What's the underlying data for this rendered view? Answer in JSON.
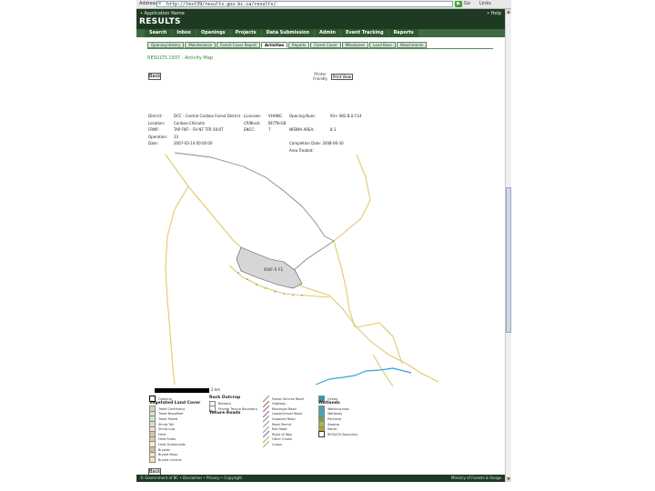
{
  "browser": {
    "address_label": "Address",
    "url": "http://test39/results.gov.bc.ca/results/",
    "go_label": "Go",
    "links_label": "Links"
  },
  "header": {
    "app_name": "• Application Name",
    "help_label": "• Help",
    "brand": "RESULTS"
  },
  "nav": {
    "items": [
      "Search",
      "Inbox",
      "Openings",
      "Projects",
      "Data Submission",
      "Admin",
      "Event Tracking",
      "Reports"
    ]
  },
  "subtabs": {
    "items": [
      "Opening History",
      "Maintenance",
      "Forest Cover Report",
      "Activities",
      "Reports",
      "Forest Cover",
      "Milestones",
      "Land Base",
      "Attachments"
    ],
    "active_index": 3
  },
  "page": {
    "title": "RESULTS 1937 - Activity Map",
    "back_label": "Back",
    "print_hint": "Printer Friendly",
    "print_label": "Print View"
  },
  "info": {
    "rows": [
      [
        "District:",
        "DCC - Central Cariboo Forest District",
        "Licensee:",
        "VHHNG",
        "Opening Num:",
        "93+ 082 B.0.F.14"
      ],
      [
        "Location:",
        "Cariboo-Chilcotin",
        "CP/Block:",
        "BF/TN-GB",
        "",
        ""
      ],
      [
        "FRMF:",
        "TAP FNT – FH NT TFR 58 BT",
        "ENCC:",
        "7",
        "NFBMA AREA:",
        "8.1"
      ],
      [
        "Operation:",
        "33",
        "",
        "",
        "",
        ""
      ],
      [
        "Date:",
        "2007-03-14 00:00:00",
        "",
        "",
        "Completion Date: 2008-06-30",
        ""
      ],
      [
        "",
        "",
        "",
        "",
        "Area Treated:",
        ""
      ]
    ]
  },
  "map": {
    "opening_label": "93/F-5 F1"
  },
  "scale": {
    "label": "2 km"
  },
  "legend": {
    "items": [
      {
        "label": "Opening",
        "kind": "box",
        "color": "#ffffff",
        "border": "#000000"
      },
      {
        "label": "Vegetated Land Cover",
        "kind": "header"
      },
      {
        "label": "Treed Coniferous",
        "kind": "box",
        "color": "#c7d9c2"
      },
      {
        "label": "Treed Broadleaf",
        "kind": "box",
        "color": "#d5e6c9"
      },
      {
        "label": "Treed Mixed",
        "kind": "box",
        "color": "#cfe3c8"
      },
      {
        "label": "Shrub Tall",
        "kind": "box",
        "color": "#e5d9c5"
      },
      {
        "label": "Shrub Low",
        "kind": "box",
        "color": "#efe3c2"
      },
      {
        "label": "Herb",
        "kind": "box",
        "color": "#d9c0a8"
      },
      {
        "label": "Herb Forbs",
        "kind": "box",
        "color": "#e6c7b2"
      },
      {
        "label": "Herb Graminoids",
        "kind": "box",
        "color": "#f6f0c8"
      },
      {
        "label": "Bryoids",
        "kind": "box",
        "color": "#c9bfa5"
      },
      {
        "label": "Bryoid Moss",
        "kind": "box",
        "color": "#efe9b9"
      },
      {
        "label": "Bryoid Lichens",
        "kind": "box",
        "color": "#e8e2c8"
      },
      {
        "label": "Rock Outcrop",
        "kind": "header"
      },
      {
        "label": "Bedrock",
        "kind": "box",
        "color": "#f3f3f3"
      },
      {
        "label": "Private Tenure Boundary",
        "kind": "box",
        "color": "#fafafa"
      },
      {
        "label": "Tenure Roads",
        "kind": "header"
      },
      {
        "label": "Forest Service Road",
        "kind": "line",
        "color": "#6aa04a"
      },
      {
        "label": "Highway",
        "kind": "line",
        "color": "#b8505f"
      },
      {
        "label": "Municipal Road",
        "kind": "line",
        "color": "#9b5b8a"
      },
      {
        "label": "Loose/Gravel Road",
        "kind": "line",
        "color": "#7a6a9a"
      },
      {
        "label": "Unpaved Road",
        "kind": "line",
        "color": "#8a8a8a"
      },
      {
        "label": "Road Permit",
        "kind": "line",
        "color": "#7a9ab0"
      },
      {
        "label": "Rail Road",
        "kind": "line",
        "color": "#9a9a9a"
      },
      {
        "label": "Right of Way",
        "kind": "line",
        "color": "#6a6ab0"
      },
      {
        "label": "Other Crown",
        "kind": "line",
        "color": "#9ab06a"
      },
      {
        "label": "Crown",
        "kind": "line",
        "color": "#c8a050"
      },
      {
        "label": "Ocean",
        "kind": "box",
        "color": "#2aa0a8"
      },
      {
        "label": "Wetlands",
        "kind": "header"
      },
      {
        "label": "Watercourses",
        "kind": "box",
        "color": "#4aa0b0"
      },
      {
        "label": "Wetlands",
        "kind": "box",
        "color": "#3ab0b8"
      },
      {
        "label": "Parkland",
        "kind": "box",
        "color": "#6aa05a"
      },
      {
        "label": "Swamp",
        "kind": "box",
        "color": "#a8b84a"
      },
      {
        "label": "Marsh",
        "kind": "box",
        "color": "#b8a82a"
      },
      {
        "label": "RESULTS Boundary",
        "kind": "box",
        "color": "#ffffff",
        "border": "#333333"
      }
    ]
  },
  "footer": {
    "left": "© Government of BC • Disclaimer • Privacy • Copyright",
    "right": "Ministry of Forests & Range"
  },
  "colors": {
    "header_bg": "#1f3a22",
    "nav_bg": "#3d6b3f",
    "road_main": "#e0c96a",
    "road_secondary": "#8a8a8a",
    "water": "#2fa6d9",
    "opening_fill": "#d6d6d6"
  }
}
